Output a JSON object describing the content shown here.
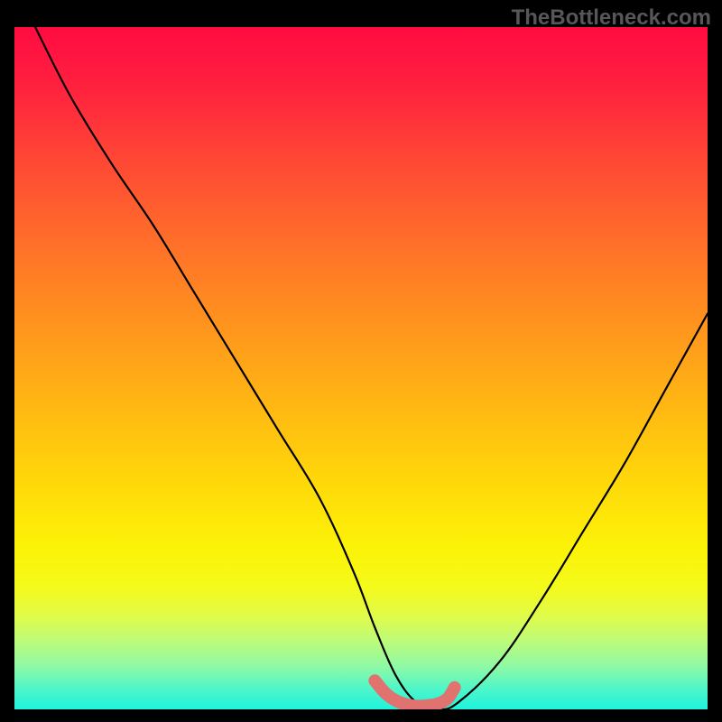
{
  "watermark": "TheBottleneck.com",
  "chart_data": {
    "type": "line",
    "title": "",
    "xlabel": "",
    "ylabel": "",
    "xlim": [
      0,
      100
    ],
    "ylim": [
      0,
      100
    ],
    "series": [
      {
        "name": "bottleneck-curve",
        "x": [
          3,
          8,
          14,
          20,
          26,
          32,
          38,
          44,
          49,
          52,
          55,
          58,
          61,
          64,
          70,
          76,
          82,
          88,
          94,
          100
        ],
        "y": [
          100,
          90,
          80,
          71,
          61,
          51,
          41,
          31,
          20,
          12,
          5,
          1,
          0,
          1,
          7,
          16,
          26,
          36,
          47,
          58
        ]
      },
      {
        "name": "optimal-range-marker",
        "x": [
          52,
          53.5,
          55,
          57,
          59,
          61,
          62.5,
          63.5
        ],
        "y": [
          4.2,
          2.4,
          1.3,
          0.6,
          0.5,
          0.8,
          1.6,
          3.2
        ]
      }
    ],
    "gradient_stops": [
      {
        "pos": 0,
        "color": "#ff0b40"
      },
      {
        "pos": 50,
        "color": "#ffb314"
      },
      {
        "pos": 80,
        "color": "#f4fa1a"
      },
      {
        "pos": 100,
        "color": "#1ef3dd"
      }
    ]
  }
}
